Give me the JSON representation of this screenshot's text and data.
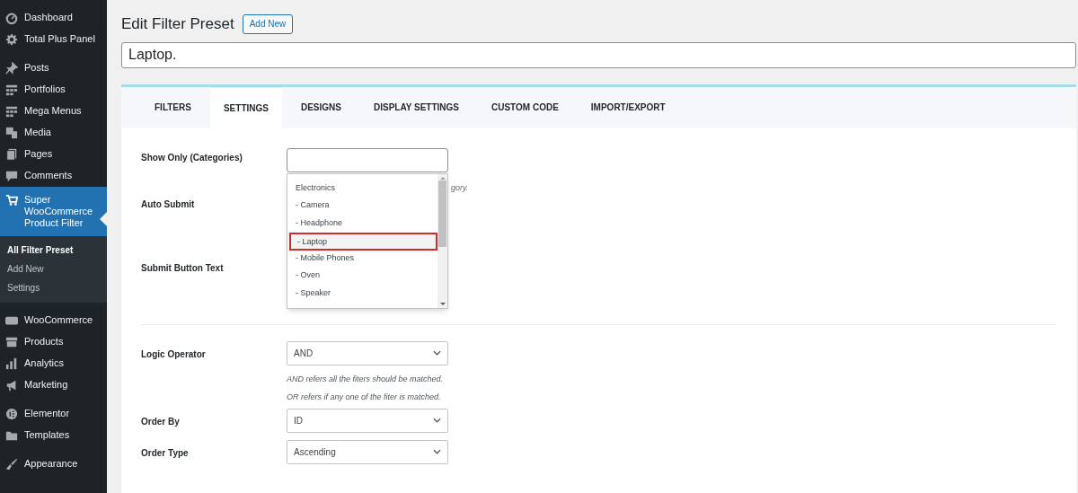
{
  "sidebar": {
    "sections": [
      [
        {
          "label": "Dashboard",
          "selected": false
        },
        {
          "label": "Total Plus Panel",
          "selected": false
        }
      ],
      [
        {
          "label": "Posts",
          "selected": false
        },
        {
          "label": "Portfolios",
          "selected": false
        },
        {
          "label": "Mega Menus",
          "selected": false
        },
        {
          "label": "Media",
          "selected": false
        },
        {
          "label": "Pages",
          "selected": false
        },
        {
          "label": "Comments",
          "selected": false
        },
        {
          "label": "Super WooCommerce Product Filter",
          "selected": true,
          "children": [
            {
              "label": "All Filter Preset",
              "selected": true
            },
            {
              "label": "Add New",
              "selected": false
            },
            {
              "label": "Settings",
              "selected": false
            }
          ]
        }
      ],
      [
        {
          "label": "WooCommerce",
          "selected": false
        },
        {
          "label": "Products",
          "selected": false
        },
        {
          "label": "Analytics",
          "selected": false
        },
        {
          "label": "Marketing",
          "selected": false
        }
      ],
      [
        {
          "label": "Elementor",
          "selected": false
        },
        {
          "label": "Templates",
          "selected": false
        }
      ],
      [
        {
          "label": "Appearance",
          "selected": false
        }
      ]
    ]
  },
  "page": {
    "title": "Edit Filter Preset",
    "add_new_button": "Add New",
    "preset_name": "Laptop."
  },
  "tabs": [
    {
      "label": "FILTERS",
      "selected": false
    },
    {
      "label": "SETTINGS",
      "selected": true
    },
    {
      "label": "DESIGNS",
      "selected": false
    },
    {
      "label": "DISPLAY SETTINGS",
      "selected": false
    },
    {
      "label": "CUSTOM CODE",
      "selected": false
    },
    {
      "label": "IMPORT/EXPORT",
      "selected": false
    }
  ],
  "settings": [
    {
      "kind": "multiselect",
      "label": "Show Only (Categories)",
      "hints": [
        "gory."
      ],
      "dropdown": {
        "options": [
          {
            "label": "Electronics",
            "highlighted": false
          },
          {
            "label": "- Camera",
            "highlighted": false
          },
          {
            "label": "- Headphone",
            "highlighted": false
          },
          {
            "label": "- Laptop",
            "highlighted": true
          },
          {
            "label": "- Mobile Phones",
            "highlighted": false
          },
          {
            "label": "- Oven",
            "highlighted": false
          },
          {
            "label": "- Speaker",
            "highlighted": false
          }
        ]
      }
    },
    {
      "kind": "hidden",
      "label": "Auto Submit"
    },
    {
      "kind": "hidden",
      "label": "Submit Button Text"
    },
    {
      "kind": "divider"
    },
    {
      "kind": "select",
      "label": "Logic Operator",
      "value": "AND",
      "hints": [
        "AND refers all the fiters should be matched.",
        "OR refers if any one of the fiter is matched."
      ]
    },
    {
      "kind": "select",
      "label": "Order By",
      "value": "ID"
    },
    {
      "kind": "select",
      "label": "Order Type",
      "value": "Ascending"
    }
  ]
}
